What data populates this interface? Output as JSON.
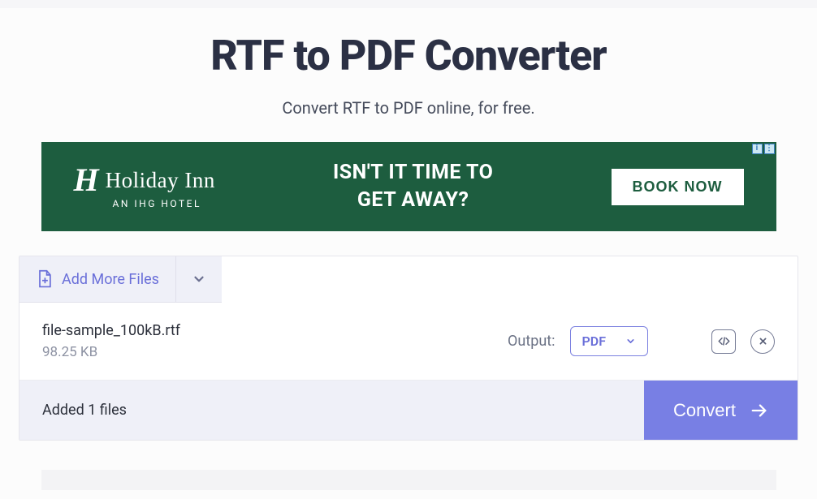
{
  "header": {
    "title": "RTF to PDF Converter",
    "subtitle": "Convert RTF to PDF online, for free."
  },
  "ad": {
    "logo_initial": "H",
    "logo_name": "Holiday Inn",
    "logo_sub": "AN IHG HOTEL",
    "line1": "ISN'T IT TIME TO",
    "line2": "GET AWAY?",
    "cta": "BOOK NOW",
    "info_glyph": "i",
    "close_glyph": "⋮"
  },
  "panel": {
    "add_label": "Add More Files",
    "file": {
      "name": "file-sample_100kB.rtf",
      "size": "98.25 KB"
    },
    "output_label": "Output:",
    "output_format": "PDF",
    "footer_status": "Added 1 files",
    "convert_label": "Convert"
  }
}
